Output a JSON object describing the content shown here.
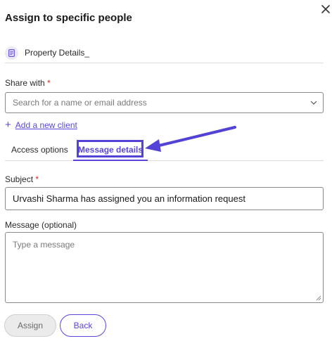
{
  "dialog": {
    "title": "Assign to specific people",
    "file_name": "Property Details_"
  },
  "share": {
    "label": "Share with",
    "required_mark": "*",
    "placeholder": "Search for a name or email address",
    "add_client_label": "Add a new client"
  },
  "tabs": [
    {
      "label": "Access options",
      "active": false
    },
    {
      "label": "Message details",
      "active": true
    }
  ],
  "subject": {
    "label": "Subject",
    "required_mark": "*",
    "value": "Urvashi Sharma has assigned you an information request"
  },
  "message": {
    "label": "Message (optional)",
    "placeholder": "Type a message"
  },
  "buttons": {
    "assign": "Assign",
    "back": "Back"
  },
  "colors": {
    "accent": "#5a46d8",
    "annotation": "#5243d6",
    "required": "#d92d20"
  }
}
